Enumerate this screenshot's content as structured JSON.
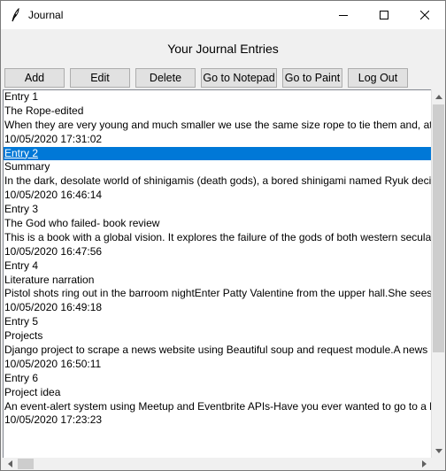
{
  "window": {
    "title": "Journal"
  },
  "heading": "Your Journal Entries",
  "toolbar": {
    "add": "Add",
    "edit": "Edit",
    "delete": "Delete",
    "notepad": "Go to Notepad",
    "paint": "Go to Paint",
    "logout": "Log Out"
  },
  "entries": [
    {
      "label": "Entry 1",
      "title": "The Rope-edited",
      "text": "When they are very young and much smaller we use the same size rope to tie them and, at t",
      "date": "10/05/2020 17:31:02"
    },
    {
      "label": "Entry 2",
      "title": "Summary",
      "text": "In the dark, desolate world of shinigamis (death gods), a bored shinigami named Ryuk deci",
      "date": "10/05/2020 16:46:14"
    },
    {
      "label": "Entry 3",
      "title": "The God who failed- book review",
      "text": "This is a book with a global vision. It explores the failure of the gods of both western secular",
      "date": "10/05/2020 16:47:56"
    },
    {
      "label": "Entry 4",
      "title": "Literature narration",
      "text": "Pistol shots ring out in the barroom nightEnter Patty Valentine from the upper hall.She sees",
      "date": "10/05/2020 16:49:18"
    },
    {
      "label": "Entry 5",
      "title": "Projects",
      "text": "Django project to scrape a news website using Beautiful soup and request module.A news a",
      "date": "10/05/2020 16:50:11"
    },
    {
      "label": "Entry 6",
      "title": "Project idea",
      "text": "An event-alert system using Meetup and Eventbrite APIs-Have you ever wanted to go to a b",
      "date": "10/05/2020 17:23:23"
    }
  ],
  "selected_line": "Entry 2",
  "colors": {
    "selection": "#0078d7",
    "button_face": "#e1e1e1",
    "window_bg": "#f0f0f0"
  }
}
